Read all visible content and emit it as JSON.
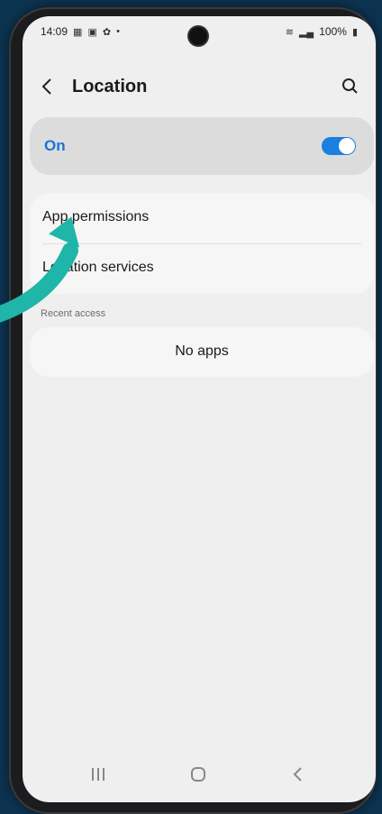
{
  "status_bar": {
    "time": "14:09",
    "battery": "100%",
    "left_icons": [
      "qr-icon",
      "gallery-icon",
      "settings-icon",
      "dot-icon"
    ],
    "right_icons": [
      "wifi-icon",
      "signal-icon",
      "battery-icon"
    ]
  },
  "header": {
    "title": "Location"
  },
  "location_toggle": {
    "label": "On",
    "state": true,
    "accent_color": "#1b74d6"
  },
  "menu": {
    "items": [
      {
        "label": "App permissions"
      },
      {
        "label": "Location services"
      }
    ]
  },
  "recent_access": {
    "header": "Recent access",
    "empty_text": "No apps"
  },
  "navigation": {
    "buttons": [
      "recents",
      "home",
      "back"
    ]
  },
  "overlay": {
    "arrow_color": "#1fb5a8"
  }
}
